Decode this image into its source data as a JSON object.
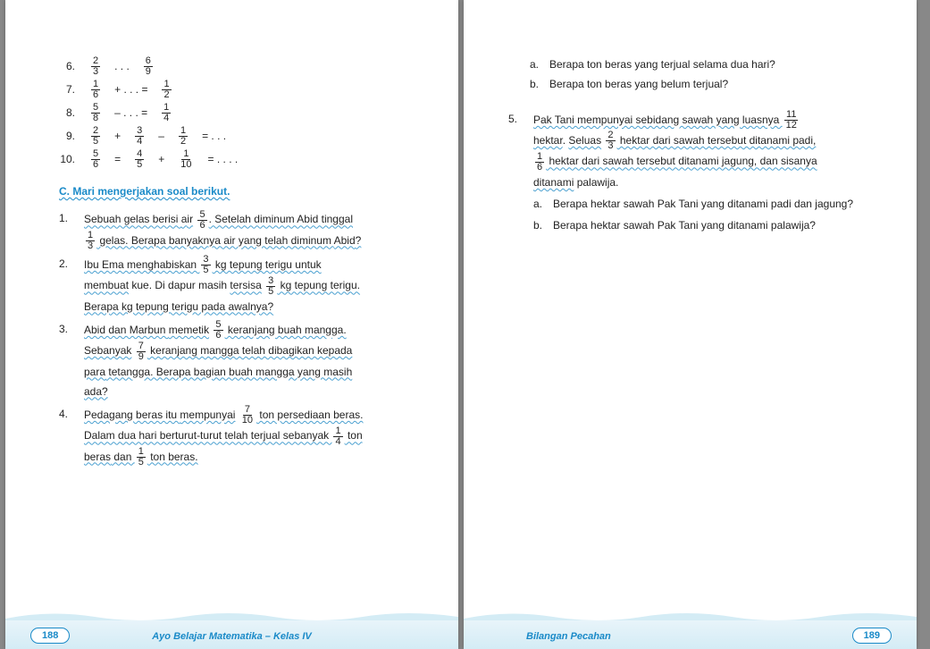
{
  "left": {
    "equations": [
      {
        "n": "6.",
        "parts": [
          "frac:2/3",
          "text:. . .",
          "frac:6/9"
        ]
      },
      {
        "n": "7.",
        "parts": [
          "frac:1/6",
          "text:+ . . . =",
          "frac:1/2"
        ]
      },
      {
        "n": "8.",
        "parts": [
          "frac:5/8",
          "text:– . . . =",
          "frac:1/4"
        ]
      },
      {
        "n": "9.",
        "parts": [
          "frac:2/5",
          "text:+",
          "frac:3/4",
          "text:–",
          "frac:1/2",
          "text:= . . ."
        ]
      },
      {
        "n": "10.",
        "parts": [
          "frac:5/6",
          "text:=",
          "frac:4/5",
          "text:+",
          "frac:1/10",
          "text:= . . . ."
        ]
      }
    ],
    "sectionHead": "C. Mari mengerjakan soal berikut.",
    "problems": [
      {
        "n": "1.",
        "runs": [
          {
            "t": "Sebuah gelas berisi ",
            "u": 1
          },
          {
            "t": "air",
            "u": 1
          },
          {
            "t": " "
          },
          {
            "f": "5/6"
          },
          {
            "t": ". Setelah diminum Abid tinggal ",
            "u": 1
          },
          {
            "br": 1
          },
          {
            "f": "1/3"
          },
          {
            "t": " gelas. Berapa banyaknya air yang telah diminum ",
            "u": 1
          },
          {
            "t": "Abid",
            "u": 1
          },
          {
            "t": "?",
            "u": 1
          }
        ]
      },
      {
        "n": "2.",
        "runs": [
          {
            "t": "Ibu Ema menghabiskan ",
            "u": 1
          },
          {
            "f": "3/5"
          },
          {
            "t": " kg tepung terigu untuk",
            "u": 1
          },
          {
            "br": 1
          },
          {
            "t": "membuat",
            "u": 1
          },
          {
            "t": " kue. Di dapur masih "
          },
          {
            "t": "tersisa",
            "u": 1
          },
          {
            "t": " "
          },
          {
            "f": "3/5"
          },
          {
            "t": " kg tepung terigu.",
            "u": 1
          },
          {
            "br": 1
          },
          {
            "t": "Berapa kg tepung terigu pada awalnya?",
            "u": 1
          }
        ]
      },
      {
        "n": "3.",
        "runs": [
          {
            "t": "Abid dan Marbun ",
            "u": 1
          },
          {
            "t": "memetik",
            "u": 1
          },
          {
            "t": " "
          },
          {
            "f": "5/6"
          },
          {
            "t": " keranjang buah mangga.",
            "u": 1
          },
          {
            "br": 1
          },
          {
            "t": "Sebanyak",
            "u": 1
          },
          {
            "t": " "
          },
          {
            "f": "7/9"
          },
          {
            "t": " keranjang mangga telah dibagikan kepada",
            "u": 1
          },
          {
            "br": 1
          },
          {
            "t": "para",
            "u": 1
          },
          {
            "t": " tetangga. Berapa bagian buah mangga yang masih",
            "u": 1
          },
          {
            "br": 1
          },
          {
            "t": "ada?",
            "u": 1
          }
        ]
      },
      {
        "n": "4.",
        "runs": [
          {
            "t": "Pedagang beras itu ",
            "u": 1
          },
          {
            "t": "mempunyai",
            "u": 1
          },
          {
            "t": " "
          },
          {
            "f": "7/10"
          },
          {
            "t": " ton persediaan beras.",
            "u": 1
          },
          {
            "br": 1
          },
          {
            "t": "Dalam dua hari berturut-turut telah terjual sebanyak ",
            "u": 1
          },
          {
            "f": "1/4"
          },
          {
            "t": " ton",
            "u": 1
          },
          {
            "br": 1
          },
          {
            "t": "beras",
            "u": 1
          },
          {
            "t": " dan ",
            "u": 1
          },
          {
            "f": "1/5"
          },
          {
            "t": " ton beras.",
            "u": 1
          }
        ]
      }
    ],
    "footTitle": "Ayo Belajar Matematika – Kelas IV",
    "pageNum": "188"
  },
  "right": {
    "subQuestions4": [
      {
        "l": "a.",
        "t": "Berapa ton beras yang terjual selama dua hari?"
      },
      {
        "l": "b.",
        "t": "Berapa ton beras yang belum terjual?"
      }
    ],
    "problem5": {
      "n": "5.",
      "runs": [
        {
          "t": "Pak Tani mempunyai sebidang sawah yang luasnya ",
          "u": 1
        },
        {
          "f": "11/12"
        },
        {
          "br": 1
        },
        {
          "t": "hektar",
          "u": 1
        },
        {
          "t": ". "
        },
        {
          "t": "Seluas",
          "u": 1
        },
        {
          "t": " "
        },
        {
          "f": "2/3"
        },
        {
          "t": " hektar dari sawah tersebut ditanami padi,",
          "u": 1
        },
        {
          "br": 1
        },
        {
          "f": "1/6"
        },
        {
          "t": " hektar dari sawah tersebut ditanami jagung, dan sisanya",
          "u": 1
        },
        {
          "br": 1
        },
        {
          "t": "ditanami",
          "u": 1
        },
        {
          "t": " palawija."
        }
      ],
      "subs": [
        {
          "l": "a.",
          "t": "Berapa hektar sawah Pak Tani yang ditanami padi dan jagung?"
        },
        {
          "l": "b.",
          "t": "Berapa hektar sawah Pak Tani yang ditanami palawija?"
        }
      ]
    },
    "footTitle": "Bilangan Pecahan",
    "pageNum": "189"
  }
}
